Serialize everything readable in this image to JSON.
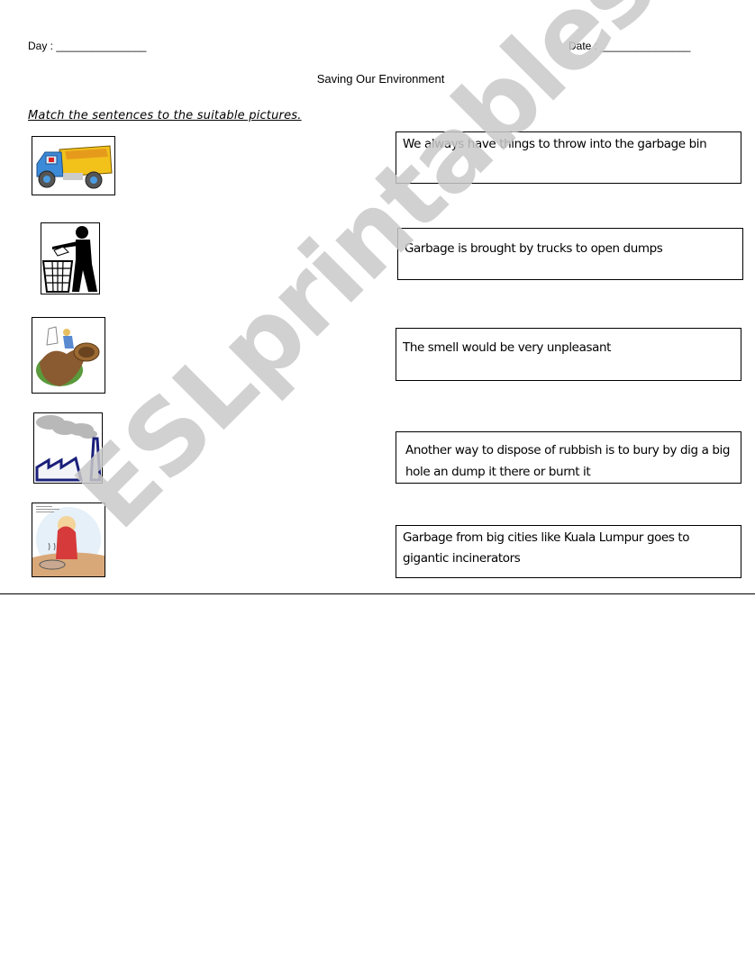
{
  "header": {
    "day_label": "Day : _______________",
    "date_label": "Date : _______________",
    "title": "Saving Our Environment"
  },
  "instructions": "Match the sentences to the suitable pictures.",
  "pictures": [
    {
      "name": "dump-truck",
      "icon": "dump-truck-icon"
    },
    {
      "name": "person-throwing-garbage-in-bin",
      "icon": "litter-bin-icon"
    },
    {
      "name": "digging-hole",
      "icon": "digging-hole-icon"
    },
    {
      "name": "factory-smoke",
      "icon": "factory-icon"
    },
    {
      "name": "bad-smell",
      "icon": "bad-smell-icon"
    }
  ],
  "sentences": [
    "We always have things to throw into the garbage bin",
    "Garbage is brought by trucks to open dumps",
    "The smell would be very unpleasant",
    "Another way to dispose of rubbish is to bury by dig a big hole an dump it there or burnt it",
    "Garbage from big cities like Kuala Lumpur goes to gigantic incinerators"
  ],
  "watermark": "ESLprintables.com",
  "colors": {
    "watermark": "#c9c9c9",
    "border": "#000000"
  }
}
